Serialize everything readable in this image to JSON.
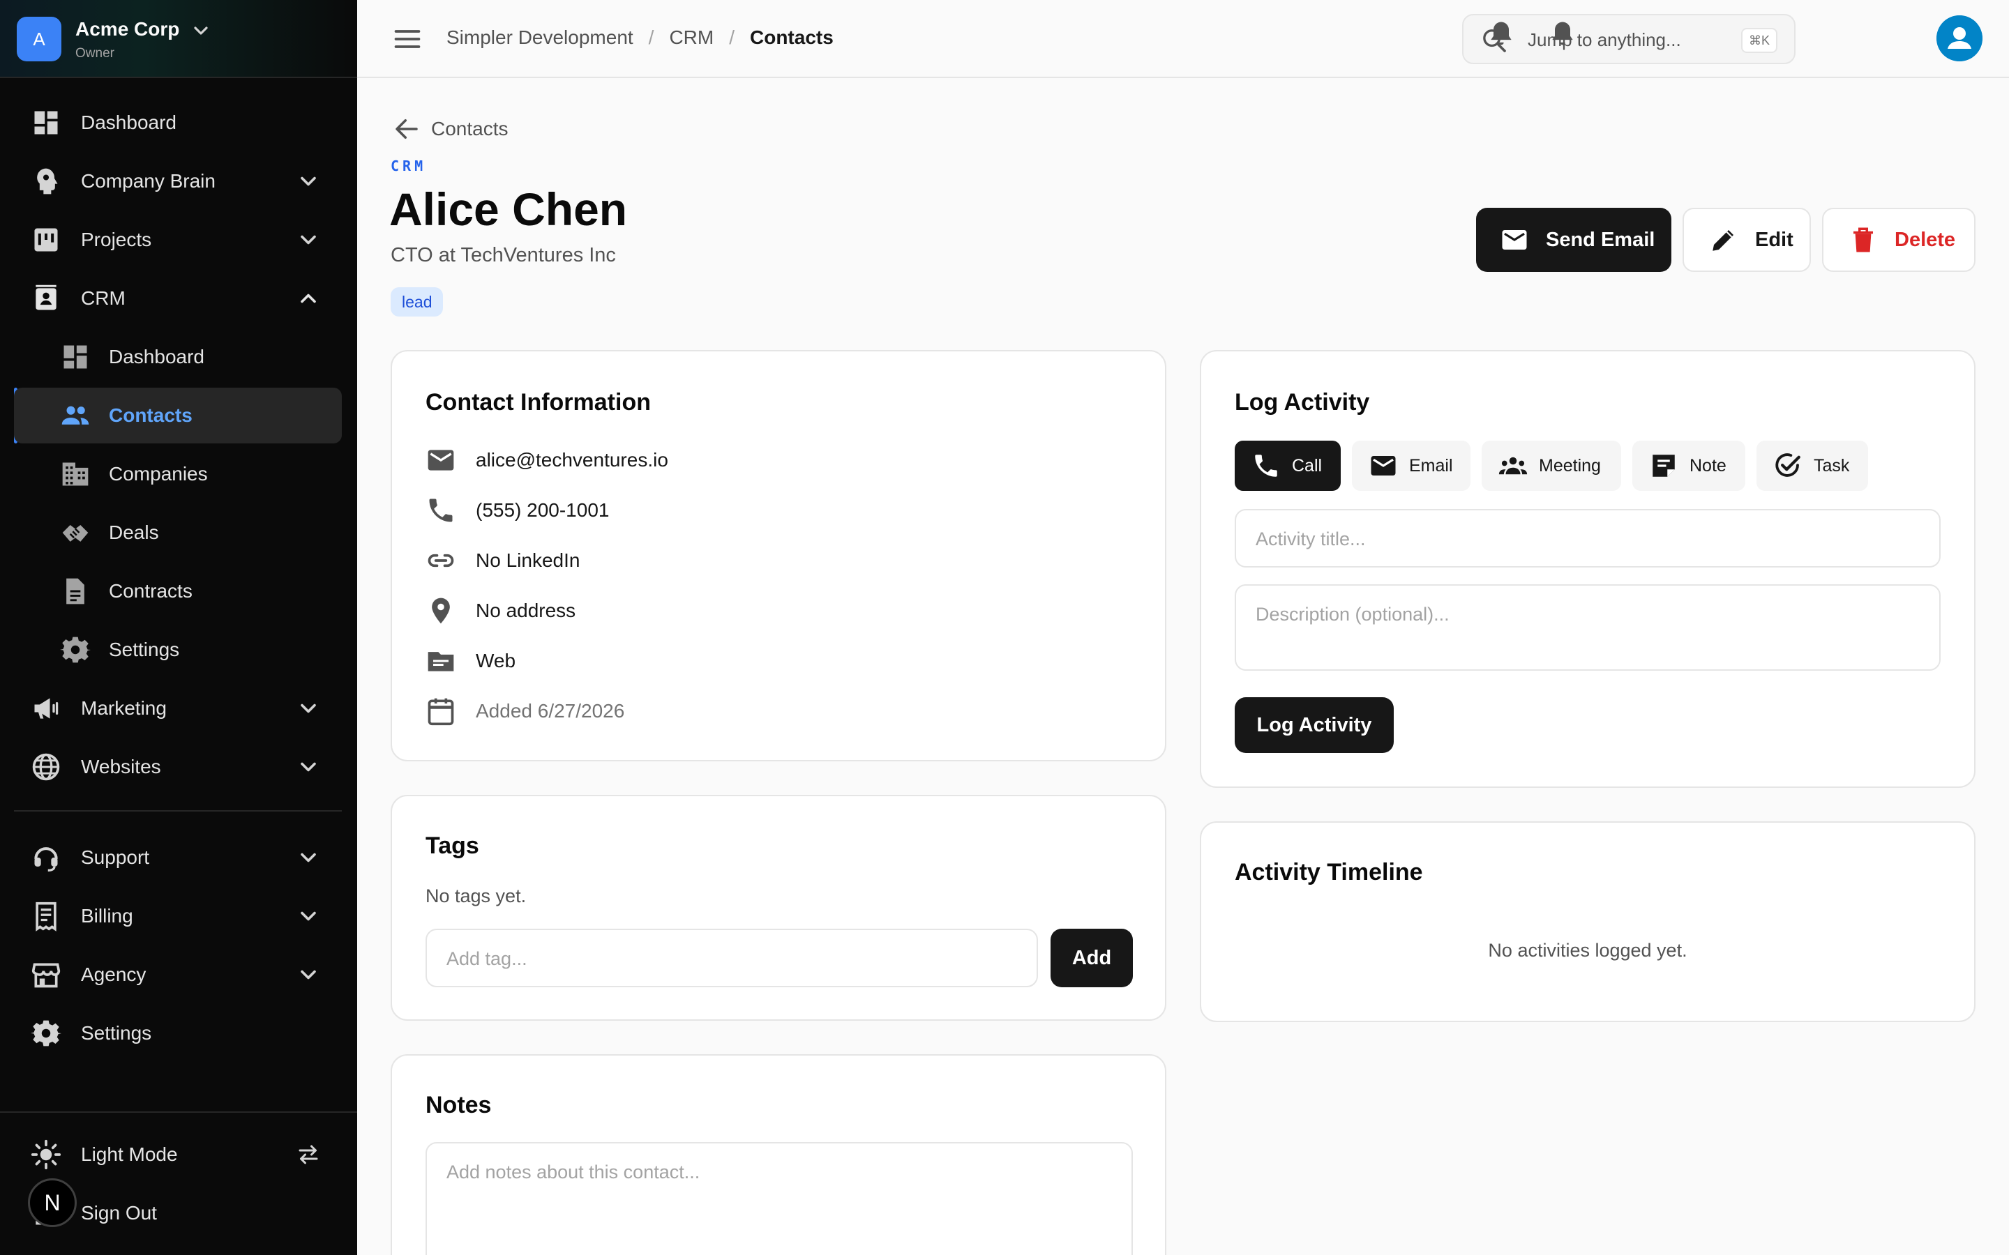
{
  "org": {
    "initial": "A",
    "name": "Acme Corp",
    "role": "Owner"
  },
  "sidebar": {
    "items": [
      {
        "label": "Dashboard"
      },
      {
        "label": "Company Brain"
      },
      {
        "label": "Projects"
      },
      {
        "label": "CRM"
      },
      {
        "label": "Marketing"
      },
      {
        "label": "Websites"
      },
      {
        "label": "Support"
      },
      {
        "label": "Billing"
      },
      {
        "label": "Agency"
      },
      {
        "label": "Settings"
      }
    ],
    "crm_sub": [
      {
        "label": "Dashboard"
      },
      {
        "label": "Contacts"
      },
      {
        "label": "Companies"
      },
      {
        "label": "Deals"
      },
      {
        "label": "Contracts"
      },
      {
        "label": "Settings"
      }
    ],
    "light_mode": "Light Mode",
    "sign_out": "Sign Out",
    "badge": "N"
  },
  "header": {
    "breadcrumbs": [
      "Simpler Development",
      "CRM",
      "Contacts"
    ],
    "separator": "/",
    "search_placeholder": "Jump to anything...",
    "search_shortcut": "⌘K"
  },
  "page": {
    "back_label": "Contacts",
    "section": "CRM",
    "name": "Alice Chen",
    "subtitle": "CTO at TechVentures Inc",
    "status_tag": "lead",
    "actions": {
      "send_email": "Send Email",
      "edit": "Edit",
      "delete": "Delete"
    }
  },
  "contact_info": {
    "title": "Contact Information",
    "email": "alice@techventures.io",
    "phone": "(555) 200-1001",
    "linkedin": "No LinkedIn",
    "address": "No address",
    "source": "Web",
    "added": "Added 6/27/2026"
  },
  "tags": {
    "title": "Tags",
    "empty": "No tags yet.",
    "placeholder": "Add tag...",
    "add_label": "Add"
  },
  "notes": {
    "title": "Notes",
    "placeholder": "Add notes about this contact..."
  },
  "log_activity": {
    "title": "Log Activity",
    "types": [
      "Call",
      "Email",
      "Meeting",
      "Note",
      "Task"
    ],
    "selected": "Call",
    "title_placeholder": "Activity title...",
    "desc_placeholder": "Description (optional)...",
    "submit_label": "Log Activity"
  },
  "timeline": {
    "title": "Activity Timeline",
    "empty": "No activities logged yet."
  },
  "colors": {
    "accent": "#3b82f6",
    "danger": "#dc2626",
    "dark": "#171717",
    "sidebar_bg": "#0a0a0a"
  }
}
